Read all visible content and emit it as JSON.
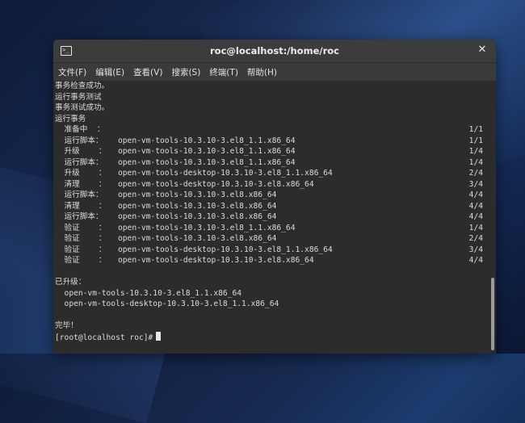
{
  "window": {
    "title": "roc@localhost:/home/roc",
    "terminal_icon": "terminal-icon",
    "close_icon": "close-icon"
  },
  "menu": [
    {
      "label": "文件(F)"
    },
    {
      "label": "编辑(E)"
    },
    {
      "label": "查看(V)"
    },
    {
      "label": "搜索(S)"
    },
    {
      "label": "终端(T)"
    },
    {
      "label": "帮助(H)"
    }
  ],
  "terminal": {
    "pre_lines": [
      "事务检查成功。",
      "运行事务测试",
      "事务测试成功。",
      "运行事务"
    ],
    "steps": [
      {
        "action": "  准备中  ：",
        "package": "",
        "count": "1/1"
      },
      {
        "action": "  运行脚本：",
        "package": "open-vm-tools-10.3.10-3.el8_1.1.x86_64",
        "count": "1/1"
      },
      {
        "action": "  升级    ：",
        "package": "open-vm-tools-10.3.10-3.el8_1.1.x86_64",
        "count": "1/4"
      },
      {
        "action": "  运行脚本：",
        "package": "open-vm-tools-10.3.10-3.el8_1.1.x86_64",
        "count": "1/4"
      },
      {
        "action": "  升级    ：",
        "package": "open-vm-tools-desktop-10.3.10-3.el8_1.1.x86_64",
        "count": "2/4"
      },
      {
        "action": "  清理    ：",
        "package": "open-vm-tools-desktop-10.3.10-3.el8.x86_64",
        "count": "3/4"
      },
      {
        "action": "  运行脚本：",
        "package": "open-vm-tools-10.3.10-3.el8.x86_64",
        "count": "4/4"
      },
      {
        "action": "  清理    ：",
        "package": "open-vm-tools-10.3.10-3.el8.x86_64",
        "count": "4/4"
      },
      {
        "action": "  运行脚本：",
        "package": "open-vm-tools-10.3.10-3.el8.x86_64",
        "count": "4/4"
      },
      {
        "action": "  验证    ：",
        "package": "open-vm-tools-10.3.10-3.el8_1.1.x86_64",
        "count": "1/4"
      },
      {
        "action": "  验证    ：",
        "package": "open-vm-tools-10.3.10-3.el8.x86_64",
        "count": "2/4"
      },
      {
        "action": "  验证    ：",
        "package": "open-vm-tools-desktop-10.3.10-3.el8_1.1.x86_64",
        "count": "3/4"
      },
      {
        "action": "  验证    ：",
        "package": "open-vm-tools-desktop-10.3.10-3.el8.x86_64",
        "count": "4/4"
      }
    ],
    "upgraded_header": "已升级：",
    "upgraded": [
      "  open-vm-tools-10.3.10-3.el8_1.1.x86_64",
      "  open-vm-tools-desktop-10.3.10-3.el8_1.1.x86_64"
    ],
    "complete": "完毕！",
    "prompt": "[root@localhost roc]#"
  }
}
